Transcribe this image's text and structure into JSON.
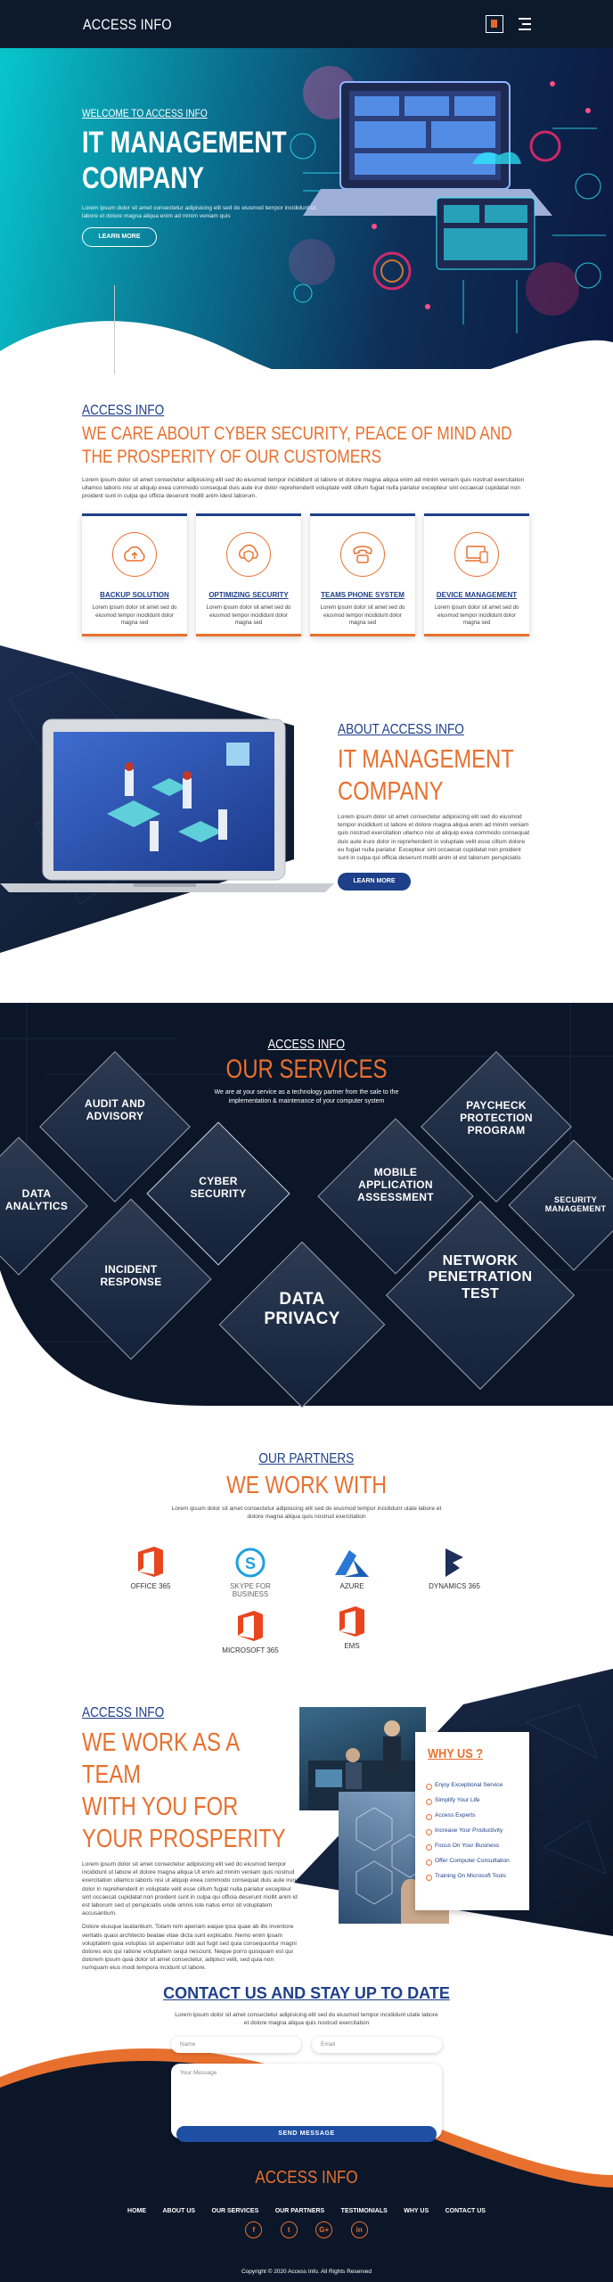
{
  "header": {
    "brand": "ACCESS INFO"
  },
  "hero": {
    "kicker": "WELCOME TO ACCESS INFO",
    "title_line1": "IT MANAGEMENT",
    "title_line2": "COMPANY",
    "text": "Lorem ipsum dolor sit amet consectetur adipisicing elit sed do eiusmod tempor incididunt ut labore et dolore magna aliqua enim ad minim veniam quis",
    "button": "LEARN MORE"
  },
  "intro": {
    "kicker": "ACCESS INFO",
    "title": "WE CARE ABOUT CYBER SECURITY, PEACE OF MIND AND THE PROSPERITY OF OUR CUSTOMERS",
    "text": "Lorem ipsum dolor sit amet consectetur adipisicing elit sed do eiusmod tempor incididunt ut labore et dolore magna aliqua enim ad minim veniam quis nostrud exercitation ullamco laboris nisi ut aliquip exea commodo consequat duis aute irur dolor reprehenderit voluptate velit cillum fugiat nulla pariatur excepteur sint occaecat cupidatat non proident sunt in culpa qui officia deserunt mollit anim idest laborum."
  },
  "cards": [
    {
      "title": "BACKUP SOLUTION",
      "text": "Lorem ipsum dolor sit amet sed do eiusmod tempor incididunt dolor magna sed",
      "icon": "cloud-upload-icon"
    },
    {
      "title": "OPTIMIZING SECURITY",
      "text": "Lorem ipsum dolor sit amet sed do eiusmod tempor incididunt dolor magna sed",
      "icon": "shield-cloud-icon"
    },
    {
      "title": "TEAMS PHONE SYSTEM",
      "text": "Lorem ipsum dolor sit amet sed do eiusmod tempor incididunt dolor magna sed",
      "icon": "phone-icon"
    },
    {
      "title": "DEVICE MANAGEMENT",
      "text": "Lorem ipsum dolor sit amet sed do eiusmod tempor incididunt dolor magna sed",
      "icon": "device-icon"
    }
  ],
  "about": {
    "kicker": "ABOUT ACCESS INFO",
    "title_line1": "IT MANAGEMENT",
    "title_line2": "COMPANY",
    "text": "Lorem ipsum dolor sit amet consectetur adipisicing elit sed do eiusmod tempor incididunt ut labore et dolore magna aliqua enim ad minim veniam quis nostrud exercitation ullamco nisi ut aliquip exea commodo consequat duis aute irure dolor in reprehenderit in voluptate velit esse cillum dolore eu fugiat nulla pariatur. Excepteur sint occaecat cupidatat non proident sunt in culpa qui officia deserunt mollit anim id est laborum perspiciatis",
    "button": "LEARN MORE"
  },
  "services": {
    "kicker": "ACCESS INFO",
    "title": "OUR SERVICES",
    "text": "We are at your service as a technology partner from the sale to the implementation & maintenance of your computer system",
    "items": {
      "audit": "AUDIT AND ADVISORY",
      "data_analytics": "DATA ANALYTICS",
      "cyber": "CYBER SECURITY",
      "incident": "INCIDENT RESPONSE",
      "data_privacy": "DATA PRIVACY",
      "mobile": "MOBILE APPLICATION ASSESSMENT",
      "paycheck": "PAYCHECK PROTECTION PROGRAM",
      "security_mgmt": "SECURITY MANAGEMENT",
      "network": "NETWORK PENETRATION TEST"
    }
  },
  "partners": {
    "kicker": "OUR PARTNERS",
    "title": "WE WORK WITH",
    "text": "Lorem ipsum dolor sit amet consectetur adipisicing elit sed do eiusmod tempor incididunt utate labore et dolore magna aliqua quis nostrud exercitation",
    "items": [
      {
        "name": "OFFICE 365"
      },
      {
        "name": "SKYPE FOR BUSINESS"
      },
      {
        "name": "AZURE"
      },
      {
        "name": "DYNAMICS 365"
      },
      {
        "name": "MICROSOFT 365"
      },
      {
        "name": "EMS"
      }
    ]
  },
  "team": {
    "kicker": "ACCESS INFO",
    "title_line1": "WE WORK AS A TEAM",
    "title_line2": "WITH YOU FOR",
    "title_line3": "YOUR PROSPERITY",
    "text1": "Lorem ipsum dolor sit amet consectetur adipisicing elit sed do eiusmod tempor incididunt ut labore et dolore magna aliqua Ut enim ad minim veniam quis nostrud exercitation ullamco laboris nisi ut aliquip exea commodo consequat duis aute irure dolor in reprehenderit in voluptate velit esse cillum fugiat nulla pariatur excepteur sint occaecat cupidatat non proident sunt in culpa qui officia deserunt mollit anim id est laborum sed ut perspiciatis unde omnis iste natus error sit voluptatem accusantium.",
    "text2": "Dolore eiusque laudantium. Totam rem aperiam eaque ipsa quae ab illo inventore veritatis quasi architecto beatae vitae dicta sunt explicabo. Nemo enim ipsam voluptatem quia voluptas sit aspernatur odit aut fugit sed quia consequuntur magni dolores eos qui ratione voluptatem sequi nesciunt. Neque porro quisquam est qui dolorem ipsum quia dolor sit amet consectetur, adipisci velit, sed quia non numquam eius modi tempora incidunt ut labore.",
    "why_title": "WHY US ?",
    "why_items": [
      "Enjoy Exceptional Service",
      "Simplify Your Life",
      "Access Experts",
      "Increase Your Productivity",
      "Focus On Your Business",
      "Offer Computer Consultation",
      "Training On Microsoft Tools"
    ]
  },
  "contact": {
    "title": "CONTACT US AND STAY UP TO DATE",
    "text": "Lorem ipsum dolor sit amet consectetur adipisicing elit sed do eiusmod tempor incididunt utate labore et dolore magna aliqua quis nostrud exercitation",
    "name_placeholder": "Name",
    "email_placeholder": "Email",
    "message_placeholder": "Your Message",
    "button": "SEND MESSAGE"
  },
  "footer": {
    "brand": "ACCESS INFO",
    "nav": [
      "HOME",
      "ABOUT US",
      "OUR SERVICES",
      "OUR PARTNERS",
      "TESTIMONIALS",
      "WHY US",
      "CONTACT US"
    ],
    "socials": [
      {
        "glyph": "f",
        "icon": "facebook-icon"
      },
      {
        "glyph": "t",
        "icon": "twitter-icon"
      },
      {
        "glyph": "G+",
        "icon": "google-plus-icon"
      },
      {
        "glyph": "in",
        "icon": "linkedin-icon"
      }
    ],
    "copyright": "Copyright © 2020 Access Info. All Rights Reserved"
  },
  "colors": {
    "navy": "#0c1a2c",
    "orange": "#e8702f",
    "blue": "#1e3f8a",
    "teal": "#08c6cc"
  }
}
